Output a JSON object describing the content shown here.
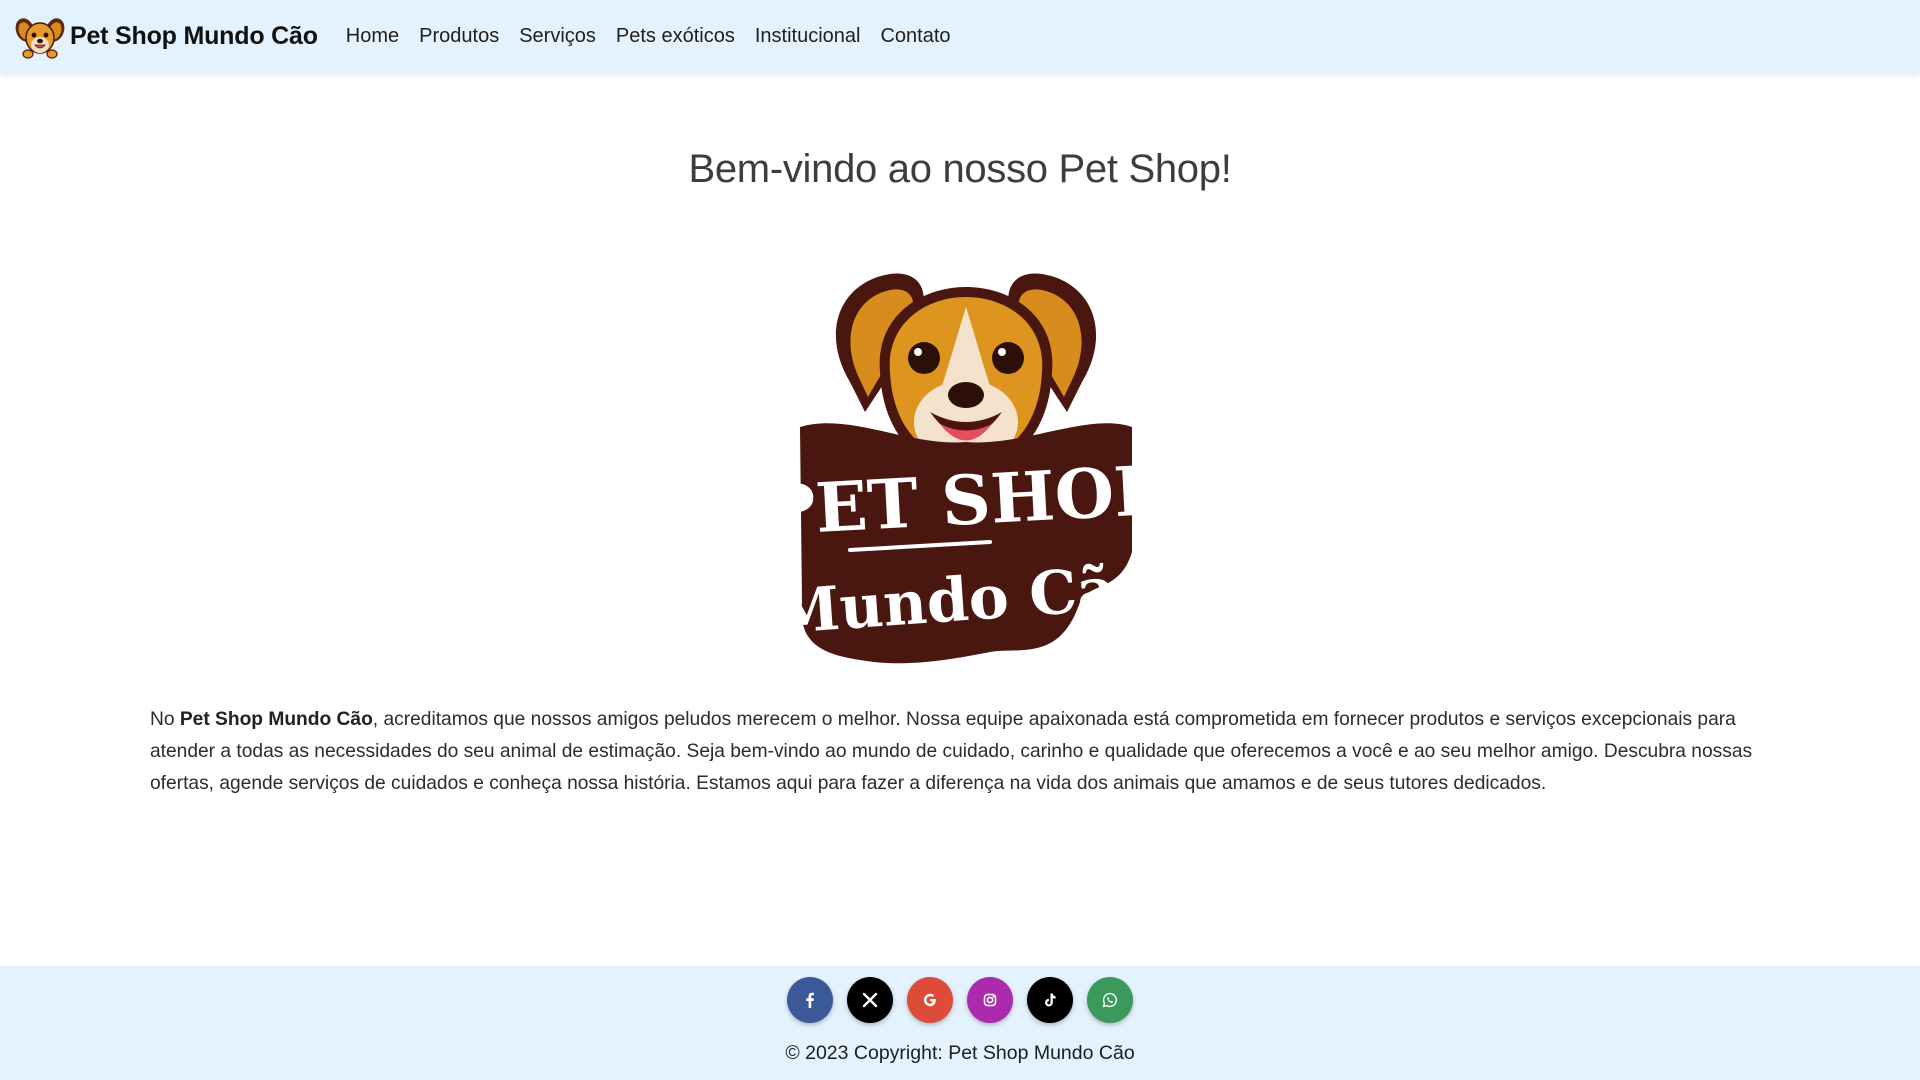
{
  "navbar": {
    "brand": "Pet Shop Mundo Cão",
    "links": [
      "Home",
      "Produtos",
      "Serviços",
      "Pets exóticos",
      "Institucional",
      "Contato"
    ]
  },
  "main": {
    "title": "Bem-vindo ao nosso Pet Shop!",
    "logo_text": [
      "PET SHOP",
      "Mundo Cão"
    ],
    "intro": {
      "prefix": "No ",
      "brand": "Pet Shop Mundo Cão",
      "body": ", acreditamos que nossos amigos peludos merecem o melhor. Nossa equipe apaixonada está comprometida em fornecer produtos e serviços excepcionais para atender a todas as necessidades do seu animal de estimação. Seja bem-vindo ao mundo de cuidado, carinho e qualidade que oferecemos a você e ao seu melhor amigo. Descubra nossas ofertas, agende serviços de cuidados e conheça nossa história. Estamos aqui para fazer a diferença na vida dos animais que amamos e de seus tutores dedicados."
    }
  },
  "footer": {
    "socials": [
      {
        "icon": "facebook-icon",
        "color": "#3b5998",
        "glyph": "f"
      },
      {
        "icon": "x-icon",
        "color": "#000000",
        "glyph": "𝕏"
      },
      {
        "icon": "google-icon",
        "color": "#dd4b39",
        "glyph": "G"
      },
      {
        "icon": "instagram-icon",
        "color": "#ac2bac",
        "glyph": ""
      },
      {
        "icon": "tiktok-icon",
        "color": "#000000",
        "glyph": "♪"
      },
      {
        "icon": "whatsapp-icon",
        "color": "#3b9a5b",
        "glyph": ""
      }
    ],
    "copyright": "© 2023 Copyright: Pet Shop Mundo Cão"
  },
  "colors": {
    "navbar_bg": "#e3f2fd",
    "footer_bg": "#e3f2fd",
    "logo_dark": "#4a1710",
    "logo_orange": "#d98c1e"
  }
}
